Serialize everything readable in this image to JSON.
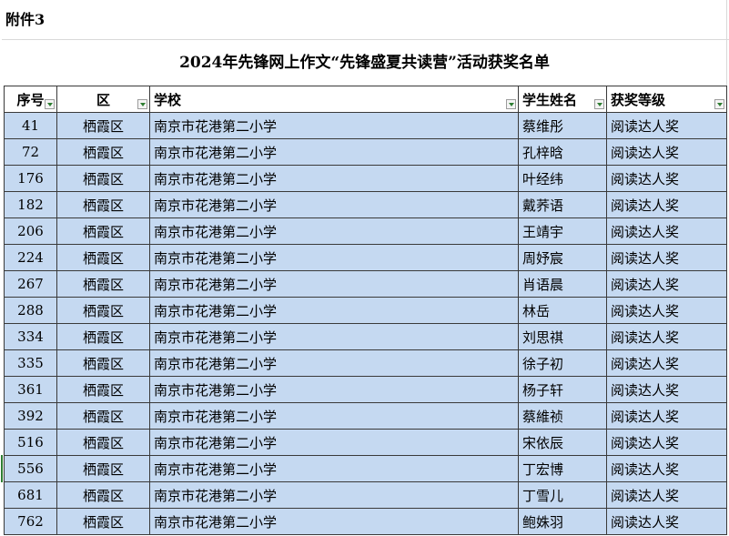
{
  "annex_label": "附件3",
  "title": "2024年先锋网上作文“先锋盛夏共读营”活动获奖名单",
  "headers": {
    "no": "序号",
    "district": "区",
    "school": "学校",
    "student": "学生姓名",
    "level": "获奖等级"
  },
  "rows": [
    {
      "no": "41",
      "district": "栖霞区",
      "school": "南京市花港第二小学",
      "student": "蔡维彤",
      "level": "阅读达人奖"
    },
    {
      "no": "72",
      "district": "栖霞区",
      "school": "南京市花港第二小学",
      "student": "孔梓晗",
      "level": "阅读达人奖"
    },
    {
      "no": "176",
      "district": "栖霞区",
      "school": "南京市花港第二小学",
      "student": "叶经纬",
      "level": "阅读达人奖"
    },
    {
      "no": "182",
      "district": "栖霞区",
      "school": "南京市花港第二小学",
      "student": "戴荞语",
      "level": "阅读达人奖"
    },
    {
      "no": "206",
      "district": "栖霞区",
      "school": "南京市花港第二小学",
      "student": "王靖宇",
      "level": "阅读达人奖"
    },
    {
      "no": "224",
      "district": "栖霞区",
      "school": "南京市花港第二小学",
      "student": "周妤宸",
      "level": "阅读达人奖"
    },
    {
      "no": "267",
      "district": "栖霞区",
      "school": "南京市花港第二小学",
      "student": "肖语晨",
      "level": "阅读达人奖"
    },
    {
      "no": "288",
      "district": "栖霞区",
      "school": "南京市花港第二小学",
      "student": "林岳",
      "level": "阅读达人奖"
    },
    {
      "no": "334",
      "district": "栖霞区",
      "school": "南京市花港第二小学",
      "student": "刘思祺",
      "level": "阅读达人奖"
    },
    {
      "no": "335",
      "district": "栖霞区",
      "school": "南京市花港第二小学",
      "student": "徐子初",
      "level": "阅读达人奖"
    },
    {
      "no": "361",
      "district": "栖霞区",
      "school": "南京市花港第二小学",
      "student": "杨子轩",
      "level": "阅读达人奖"
    },
    {
      "no": "392",
      "district": "栖霞区",
      "school": "南京市花港第二小学",
      "student": "蔡維祯",
      "level": "阅读达人奖"
    },
    {
      "no": "516",
      "district": "栖霞区",
      "school": "南京市花港第二小学",
      "student": "宋依辰",
      "level": "阅读达人奖"
    },
    {
      "no": "556",
      "district": "栖霞区",
      "school": "南京市花港第二小学",
      "student": "丁宏博",
      "level": "阅读达人奖"
    },
    {
      "no": "681",
      "district": "栖霞区",
      "school": "南京市花港第二小学",
      "student": "丁雪儿",
      "level": "阅读达人奖"
    },
    {
      "no": "762",
      "district": "栖霞区",
      "school": "南京市花港第二小学",
      "student": "鲍姝羽",
      "level": "阅读达人奖"
    }
  ]
}
